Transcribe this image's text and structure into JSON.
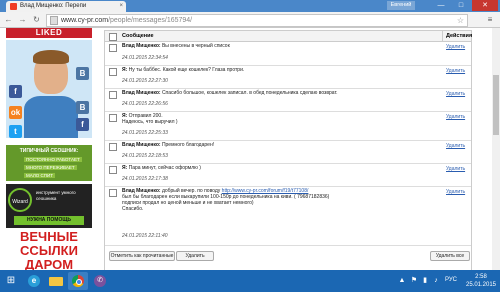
{
  "browser": {
    "tab_title": "Влад Мищенко: Перепи",
    "tab_close": "×",
    "user_label": "Евгений",
    "win_min": "—",
    "win_max": "□",
    "win_close": "✕",
    "url_host": "www.cy-pr.com",
    "url_path": "/people/messages/165794/",
    "back": "←",
    "forward": "→",
    "reload": "↻",
    "star": "☆",
    "menu": "≡"
  },
  "ads": {
    "liked": "LIKED",
    "social_fb": "f",
    "social_ok": "ok",
    "social_vk1": "B",
    "social_vk2": "B",
    "social_fb2": "f",
    "social_tw": "t",
    "green_title": "ТИПИЧНЫЙ СЕОШНИК:",
    "green_line1": "ПОСТОЯННО РАБОТАЕТ",
    "green_line2": "МНОГО ПЕРЕЖИВАЕТ",
    "green_line3": "МАЛО СПИТ",
    "wizard_logo": "Wizard",
    "wizard_text": "инструмент умного сеошника",
    "wizard_btn": "НУЖНА ПОМОЩЬ",
    "red_line1": "ВЕЧНЫЕ",
    "red_line2": "ССЫЛКИ",
    "red_line3": "ДАРОМ"
  },
  "table": {
    "col_message": "Сообщение",
    "col_actions": "Действия",
    "delete_label": "Удалить",
    "messages": [
      {
        "author": "Влад Мищенко:",
        "text": "Вы внесены в черный список",
        "date": "24.01.2015 22:34:54"
      },
      {
        "author": "Я:",
        "text": "Ну ты баббес. Какой еще кошелек? Глаза протри.",
        "date": "24.01.2015 22:27:30"
      },
      {
        "author": "Влад Мищенко:",
        "text": "Спасибо большое, кошелек записал. в обед понедельника сделаю возврат.",
        "date": "24.01.2015 22:26:56"
      },
      {
        "author": "Я:",
        "text": "Отправил 200.",
        "text2": "Надеюсь, что выручил )",
        "date": "24.01.2015 22:25:33"
      },
      {
        "author": "Влад Мищенко:",
        "text": "Премного благодарен!",
        "date": "24.01.2015 22:18:53"
      },
      {
        "author": "Я:",
        "text": "Пара минут, сейчас оформлю )",
        "date": "24.01.2015 22:17:38"
      },
      {
        "author": "Влад Мищенко:",
        "text": "добрый вечер. по поводу",
        "link": "http://www.cy-pr.com/forum/f19/t77108/",
        "text2": "был бы благодарен если выкарупили 100-150р до понедельника на киви. ( 79687182836)",
        "text3": "подписи продал но ценой меньше и не хватает немного)",
        "text4": "Спасибо.",
        "date": "24.01.2015 22:11:40"
      }
    ],
    "btn_mark_read": "Отметить как прочитанные",
    "btn_delete": "Удалить",
    "btn_delete_all": "Удалить все"
  },
  "taskbar": {
    "start": "⊞",
    "ie": "e",
    "viber": "✆",
    "lang": "РУС",
    "time": "2:58",
    "date": "25.01.2015"
  }
}
